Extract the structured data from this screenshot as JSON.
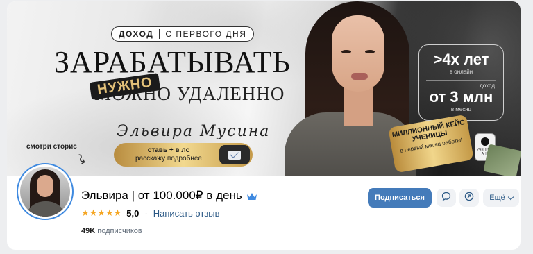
{
  "cover": {
    "income_pill_bold": "ДОХОД",
    "income_pill_rest": "С ПЕРВОГО ДНЯ",
    "headline": "ЗАРАБАТЫВАТЬ",
    "sub_headline": "МОЖНО УДАЛЕННО",
    "ribbon": "НУЖНО",
    "signature": "Эльвира Мусина",
    "cta_line1": "ставь + в лс",
    "cta_line2": "расскажу подробнее",
    "stat1_value": ">4х лет",
    "stat1_caption": "в онлайн",
    "stat2_prefix": "доход",
    "stat2_value": "от 3 млн",
    "stat2_caption": "в месяц",
    "case_title": "МИЛЛИОННЫЙ КЕЙС УЧЕНИЦЫ",
    "case_sub": "в первый месяц работы!",
    "phone_label": "УЧЕНИЦА АНЯ",
    "stories_hint": "смотри сторис"
  },
  "profile": {
    "name": "Эльвира | от 100.000₽ в день",
    "stars": "★★★★★",
    "rating": "5,0",
    "review_link": "Написать отзыв",
    "subscribers_count": "49K",
    "subscribers_label": "подписчиков"
  },
  "actions": {
    "subscribe": "Подписаться",
    "more": "Ещё"
  },
  "colors": {
    "accent": "#447bba",
    "link": "#2a5885",
    "star": "#f5a623"
  },
  "icons": {
    "crown": "crown-icon",
    "message": "message-icon",
    "share": "share-icon",
    "mail": "mail-icon"
  }
}
